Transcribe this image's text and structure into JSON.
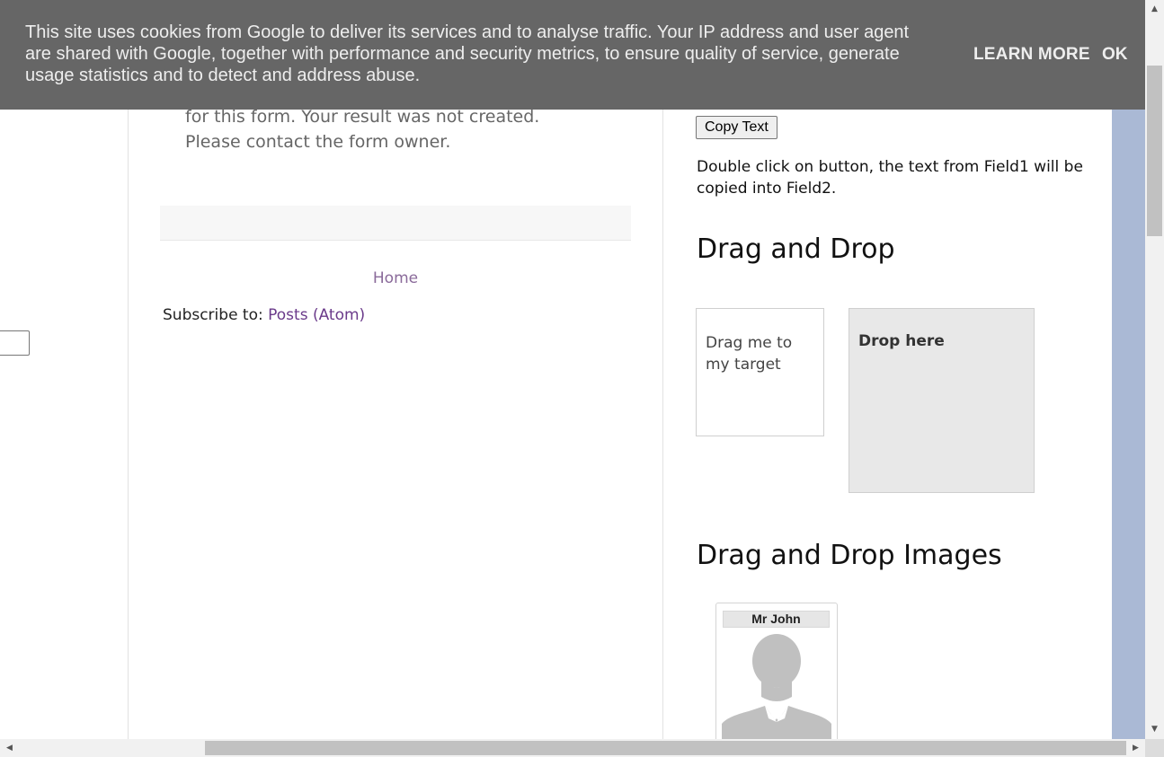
{
  "cookie_bar": {
    "message": "This site uses cookies from Google to deliver its services and to analyse traffic. Your IP address and user agent are shared with Google, together with performance and security metrics, to ensure quality of service, generate usage statistics and to detect and address abuse.",
    "learn_more_label": "LEARN MORE",
    "ok_label": "OK",
    "background_color": "#666666"
  },
  "main": {
    "form_error_lines": [
      "for this form. Your result was not created.",
      "Please contact the form owner."
    ],
    "home_link": "Home",
    "subscribe_label": "Subscribe to:",
    "subscribe_link": "Posts (Atom)"
  },
  "sidebar": {
    "copy_button_label": "Copy Text",
    "copy_description": "Double click on button, the text from Field1 will be copied into Field2.",
    "drag_drop_heading": "Drag and Drop",
    "draggable_text": "Drag me to my target",
    "droppable_text": "Drop here",
    "drag_drop_images_heading": "Drag and Drop Images",
    "image_card_name": "Mr John",
    "image_card_icon": "person-silhouette-icon"
  },
  "colors": {
    "sidebar_band": "#aab9d5",
    "link": "#6a3a8a"
  }
}
